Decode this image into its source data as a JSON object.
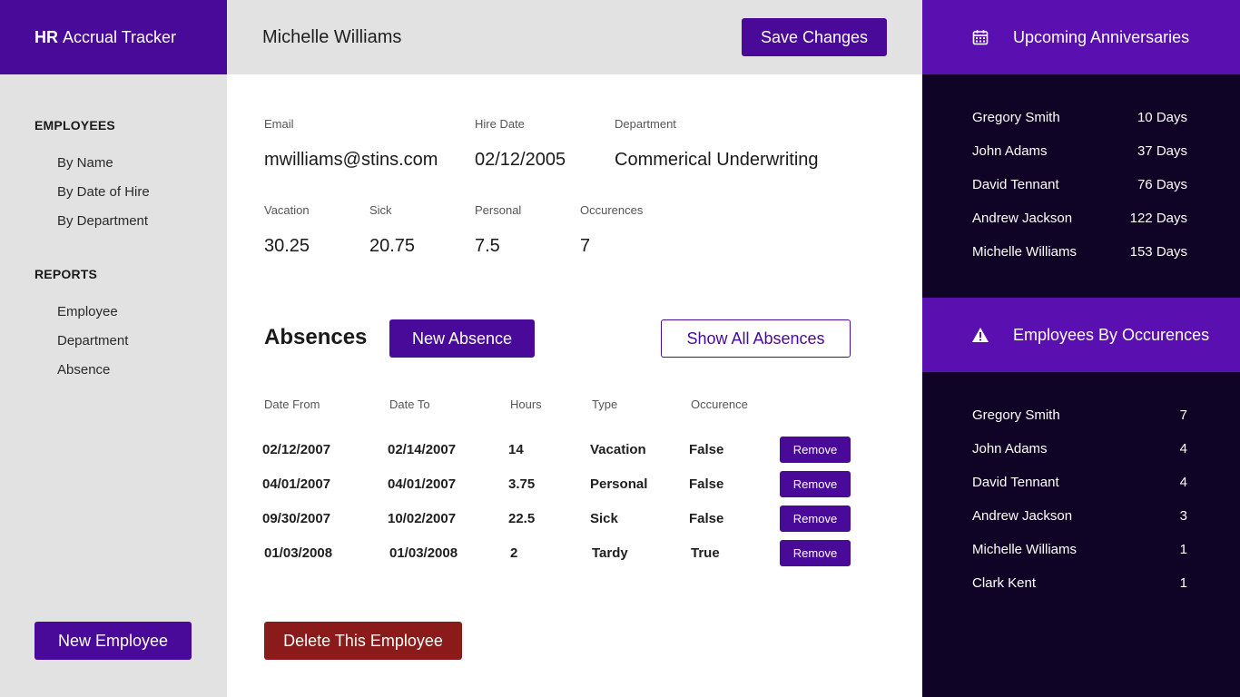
{
  "brand": {
    "bold": "HR",
    "rest": "Accrual Tracker"
  },
  "nav": {
    "employees_heading": "EMPLOYEES",
    "employees_items": [
      "By Name",
      "By Date of Hire",
      "By Department"
    ],
    "reports_heading": "REPORTS",
    "reports_items": [
      "Employee",
      "Department",
      "Absence"
    ],
    "new_employee_label": "New Employee"
  },
  "employee": {
    "name": "Michelle Williams",
    "save_label": "Save Changes",
    "email_label": "Email",
    "email": "mwilliams@stins.com",
    "hire_label": "Hire Date",
    "hire_date": "02/12/2005",
    "dept_label": "Department",
    "department": "Commerical Underwriting",
    "vacation_label": "Vacation",
    "vacation": "30.25",
    "sick_label": "Sick",
    "sick": "20.75",
    "personal_label": "Personal",
    "personal": "7.5",
    "occ_label": "Occurences",
    "occurences": "7",
    "delete_label": "Delete This Employee"
  },
  "absences": {
    "title": "Absences",
    "new_label": "New Absence",
    "show_all_label": "Show All Absences",
    "headers": [
      "Date From",
      "Date To",
      "Hours",
      "Type",
      "Occurence"
    ],
    "remove_label": "Remove",
    "rows": [
      [
        "02/12/2007",
        "02/14/2007",
        "14",
        "Vacation",
        "False"
      ],
      [
        "04/01/2007",
        "04/01/2007",
        "3.75",
        "Personal",
        "False"
      ],
      [
        "09/30/2007",
        "10/02/2007",
        "22.5",
        "Sick",
        "False"
      ],
      [
        "01/03/2008",
        "01/03/2008",
        "2",
        "Tardy",
        "True"
      ]
    ]
  },
  "anniversaries": {
    "title": "Upcoming Anniversaries",
    "icon": "calendar-icon",
    "items": [
      {
        "name": "Gregory Smith",
        "value": "10 Days"
      },
      {
        "name": "John Adams",
        "value": "37 Days"
      },
      {
        "name": "David Tennant",
        "value": "76 Days"
      },
      {
        "name": "Andrew Jackson",
        "value": "122 Days"
      },
      {
        "name": "Michelle Williams",
        "value": "153 Days"
      }
    ]
  },
  "occurences": {
    "title": "Employees By Occurences",
    "icon": "warning-icon",
    "items": [
      {
        "name": "Gregory Smith",
        "value": "7"
      },
      {
        "name": "John Adams",
        "value": "4"
      },
      {
        "name": "David Tennant",
        "value": "4"
      },
      {
        "name": "Andrew Jackson",
        "value": "3"
      },
      {
        "name": "Michelle Williams",
        "value": "1"
      },
      {
        "name": "Clark Kent",
        "value": "1"
      }
    ]
  },
  "colors": {
    "primary": "#4a0a99",
    "panel_header": "#5a0fb0",
    "dark_panel": "#0f0426",
    "danger": "#8b1a1a",
    "sidebar": "#e2e2e2"
  }
}
